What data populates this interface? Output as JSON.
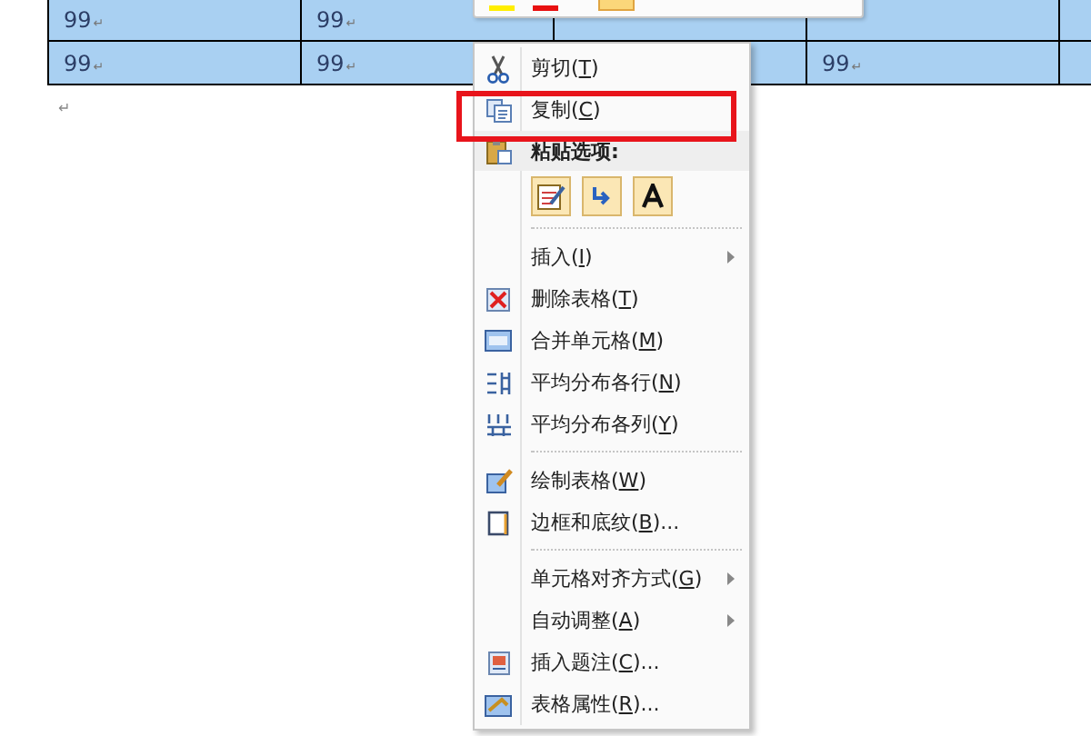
{
  "table": {
    "rows": [
      {
        "cells": [
          {
            "text": "99",
            "mark": "↵"
          },
          {
            "text": "99",
            "mark": "↵"
          },
          {},
          {},
          {}
        ]
      },
      {
        "cells": [
          {
            "text": "99",
            "mark": "↵"
          },
          {
            "text": "99",
            "mark": "↵"
          },
          {},
          {
            "text": "99",
            "mark": "↵"
          },
          {}
        ]
      }
    ]
  },
  "paragraph_mark": "↵",
  "context_menu": {
    "items": [
      {
        "kind": "item",
        "before": "剪切(",
        "key": "T",
        "after": ")",
        "submenu": false
      },
      {
        "kind": "item",
        "before": "复制(",
        "key": "C",
        "after": ")",
        "submenu": false
      },
      {
        "kind": "header",
        "text": "粘贴选项:"
      },
      {
        "kind": "paste-row"
      },
      {
        "kind": "separator"
      },
      {
        "kind": "item",
        "before": "插入(",
        "key": "I",
        "after": ")",
        "submenu": true
      },
      {
        "kind": "item",
        "before": "删除表格(",
        "key": "T",
        "after": ")",
        "submenu": false
      },
      {
        "kind": "item",
        "before": "合并单元格(",
        "key": "M",
        "after": ")",
        "submenu": false
      },
      {
        "kind": "item",
        "before": "平均分布各行(",
        "key": "N",
        "after": ")",
        "submenu": false
      },
      {
        "kind": "item",
        "before": "平均分布各列(",
        "key": "Y",
        "after": ")",
        "submenu": false
      },
      {
        "kind": "separator"
      },
      {
        "kind": "item",
        "before": "绘制表格(",
        "key": "W",
        "after": ")",
        "submenu": false
      },
      {
        "kind": "item",
        "before": "边框和底纹(",
        "key": "B",
        "after": ")...",
        "submenu": false
      },
      {
        "kind": "separator"
      },
      {
        "kind": "item",
        "before": "单元格对齐方式(",
        "key": "G",
        "after": ")",
        "submenu": true
      },
      {
        "kind": "item",
        "before": "自动调整(",
        "key": "A",
        "after": ")",
        "submenu": true
      },
      {
        "kind": "item",
        "before": "插入题注(",
        "key": "C",
        "after": ")...",
        "submenu": false
      },
      {
        "kind": "item",
        "before": "表格属性(",
        "key": "R",
        "after": ")...",
        "submenu": false
      }
    ]
  }
}
